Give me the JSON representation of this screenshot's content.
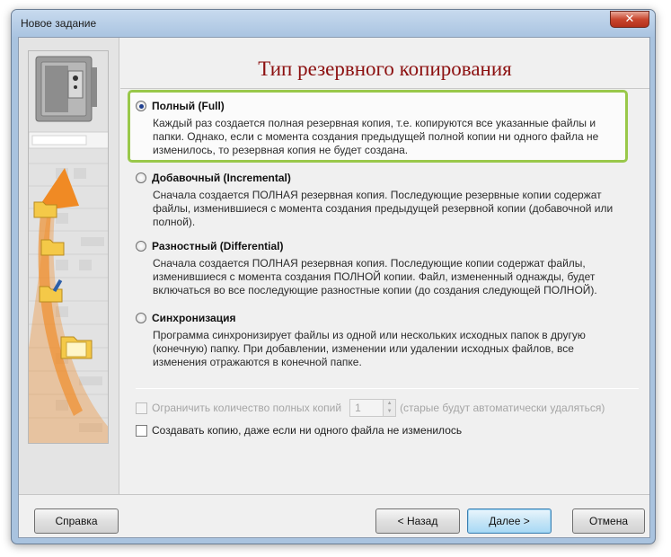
{
  "window": {
    "title": "Новое задание",
    "close_icon": "close-icon"
  },
  "page": {
    "title": "Тип резервного копирования"
  },
  "options": [
    {
      "label": "Полный (Full)",
      "checked": true,
      "description": "Каждый раз создается полная резервная копия, т.е. копируются все указанные файлы и папки. Однако, если с момента создания предыдущей полной копии ни одного файла не изменилось, то резервная копия не будет создана."
    },
    {
      "label": "Добавочный (Incremental)",
      "checked": false,
      "description": "Сначала создается ПОЛНАЯ резервная копия. Последующие резервные копии содержат файлы, изменившиеся с момента создания предыдущей резервной копии (добавочной или полной)."
    },
    {
      "label": "Разностный (Differential)",
      "checked": false,
      "description": "Сначала создается ПОЛНАЯ резервная копия. Последующие копии содержат файлы, изменившиеся с момента создания ПОЛНОЙ копии. Файл, измененный однажды, будет включаться во все последующие разностные копии (до создания следующей ПОЛНОЙ)."
    },
    {
      "label": "Синхронизация",
      "checked": false,
      "description": "Программа синхронизирует файлы из одной или нескольких исходных папок в другую (конечную) папку. При добавлении, изменении или удалении исходных файлов, все изменения отражаются в конечной папке."
    }
  ],
  "limit": {
    "label": "Ограничить количество полных копий",
    "value": "1",
    "note": "(старые будут автоматически удаляться)",
    "checked": false,
    "enabled": false
  },
  "create_anyway": {
    "label": "Создавать копию, даже если ни одного файла не изменилось",
    "checked": false
  },
  "buttons": {
    "help": "Справка",
    "back": "< Назад",
    "next": "Далее >",
    "cancel": "Отмена"
  },
  "colors": {
    "title": "#8c1010",
    "highlight": "#99c84a",
    "arrow": "#f08a24"
  },
  "side_icons": [
    "safe-icon",
    "folder-icon",
    "folder-icon",
    "folder-edit-icon",
    "folder-icon"
  ]
}
